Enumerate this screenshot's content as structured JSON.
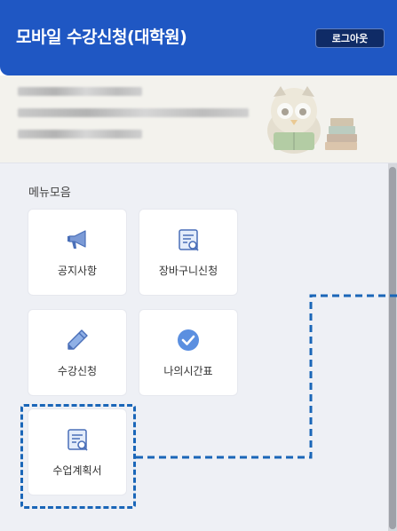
{
  "header": {
    "title": "모바일 수강신청(대학원)",
    "logout_label": "로그아웃",
    "bg_color": "#1f57c3"
  },
  "user_info": {
    "blurred": true
  },
  "menu": {
    "section_title": "메뉴모음",
    "items": [
      {
        "label": "공지사항",
        "icon": "megaphone-icon"
      },
      {
        "label": "장바구니신청",
        "icon": "document-search-icon"
      },
      {
        "label": "수강신청",
        "icon": "pencil-icon"
      },
      {
        "label": "나의시간표",
        "icon": "check-circle-icon"
      },
      {
        "label": "수업계획서",
        "icon": "document-search-icon"
      }
    ]
  },
  "annotation": {
    "highlight_color": "#1a66b8",
    "highlighted_item": "수업계획서"
  }
}
